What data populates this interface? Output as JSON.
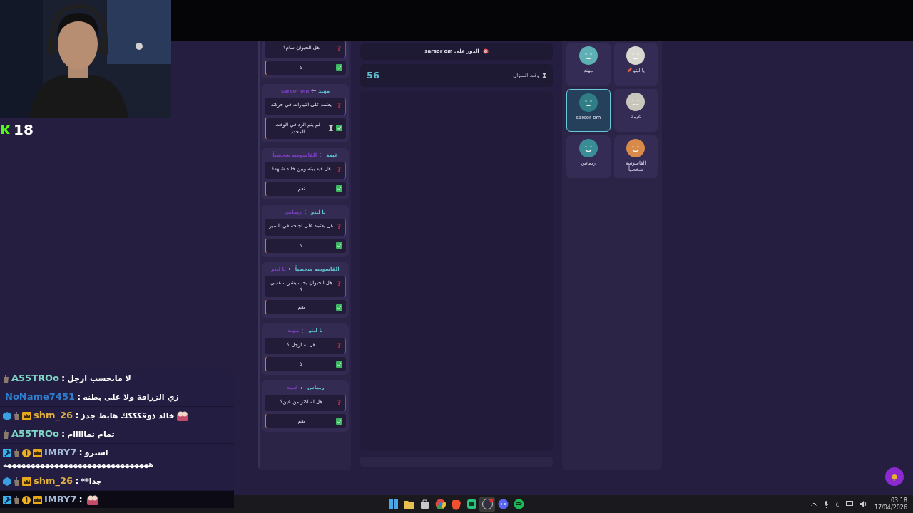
{
  "counter": {
    "value": "18"
  },
  "history": [
    {
      "mark": "?",
      "question": "هل الحيوان سام؟",
      "answer": "لا",
      "timeout": false
    },
    {
      "asker": "sarsor om",
      "target": "مهند",
      "mark": "?",
      "question": "يعتمد على التيارات في حركته",
      "answer": "لم يتم الرد في الوقت المحدد",
      "timeout": true
    },
    {
      "asker": "القاسوسه شخصياً",
      "target": "غيمة",
      "mark": "?",
      "question": "هل فيه بينه وبين خالد شبهه؟",
      "answer": "نعم",
      "timeout": false
    },
    {
      "asker": "ريماس",
      "target": "يا ليتو",
      "mark": "?",
      "question": "هل يعتمد على اجنحه في السير",
      "answer": "لا",
      "timeout": false
    },
    {
      "asker": "يا ليتو",
      "target": "القاسوسه شخصياً",
      "mark": "?",
      "question": "هل الحيوان يحب يشرب عدني ؟",
      "answer": "نعم",
      "timeout": false
    },
    {
      "asker": "مهند",
      "target": "يا ليتو",
      "mark": "?",
      "question": "هل له ارجل ؟",
      "answer": "لا",
      "timeout": false
    },
    {
      "asker": "غيمة",
      "target": "ريماس",
      "mark": "?",
      "question": "هل له اكثر من عين؟",
      "answer": "نعم",
      "timeout": false
    }
  ],
  "turn": {
    "text": "الدور على sarsor om"
  },
  "timer": {
    "label": "وقت السؤال",
    "value": "56"
  },
  "players": [
    {
      "name": "يا ليتو",
      "color": "#d8d8d0",
      "selected": false,
      "editing": true
    },
    {
      "name": "مهند",
      "color": "#5fb0b4",
      "selected": false,
      "editing": false
    },
    {
      "name": "غيمة",
      "color": "#c9c6bd",
      "selected": false,
      "editing": false
    },
    {
      "name": "sarsor om",
      "color": "#2f7d85",
      "selected": true,
      "editing": false
    },
    {
      "name": "القاسوسه شخصياً",
      "color": "#d88a4a",
      "selected": false,
      "editing": false
    },
    {
      "name": "ريماس",
      "color": "#3a8d95",
      "selected": false,
      "editing": false
    }
  ],
  "chat": [
    {
      "user": "A55TROo",
      "color": "#7fd6c4",
      "badges": [
        {
          "kind": "cup"
        }
      ],
      "separator": ":",
      "text": "لا ماتحسب ارجل",
      "emote": false,
      "highlighted": false
    },
    {
      "user": "NoName7451",
      "color": "#2f7fd0",
      "separator": ":",
      "text": "زي الزرافة ولا على بطنه",
      "emote": false,
      "highlighted": false
    },
    {
      "user": "shm_26",
      "color": "#e0b040",
      "badges": [
        {
          "kind": "cube"
        },
        {
          "kind": "cup"
        },
        {
          "kind": "crown"
        }
      ],
      "separator": ":",
      "text": "خالد ذوقكككك هابط جدز",
      "emote": true,
      "highlighted": false
    },
    {
      "user": "A55TROo",
      "color": "#7fd6c4",
      "badges": [
        {
          "kind": "cup"
        }
      ],
      "separator": ":",
      "text": "تمام تمااااام",
      "emote": false,
      "highlighted": false
    },
    {
      "user": "IMRY7",
      "color": "#a8bedc",
      "badges": [
        {
          "kind": "hammer"
        },
        {
          "kind": "cup"
        },
        {
          "kind": "one"
        },
        {
          "kind": "crown"
        }
      ],
      "separator": ":",
      "text": "استرو",
      "continuation": "هههههههههههههههههههههههههههههههه",
      "emote": false,
      "highlighted": false
    },
    {
      "user": "shm_26",
      "color": "#e0b040",
      "badges": [
        {
          "kind": "cube"
        },
        {
          "kind": "cup"
        },
        {
          "kind": "crown"
        }
      ],
      "separator": ":",
      "text": "**جدا",
      "emote": false,
      "highlighted": false
    },
    {
      "user": "IMRY7",
      "color": "#a8bedc",
      "badges": [
        {
          "kind": "hammer"
        },
        {
          "kind": "cup"
        },
        {
          "kind": "one"
        },
        {
          "kind": "crown"
        }
      ],
      "separator": ":",
      "emote": true,
      "highlighted": true
    }
  ],
  "taskbar": {
    "apps": [
      {
        "kind": "windows",
        "selected": false
      },
      {
        "kind": "folder",
        "selected": false
      },
      {
        "kind": "store",
        "selected": false
      },
      {
        "kind": "chrome",
        "selected": false
      },
      {
        "kind": "brave",
        "selected": false
      },
      {
        "kind": "chat",
        "selected": false
      },
      {
        "kind": "obs",
        "selected": true
      },
      {
        "kind": "discord",
        "selected": false
      },
      {
        "kind": "spotify",
        "selected": false
      }
    ],
    "language": "ع",
    "time": "03:18",
    "date": "17/04/2026"
  }
}
